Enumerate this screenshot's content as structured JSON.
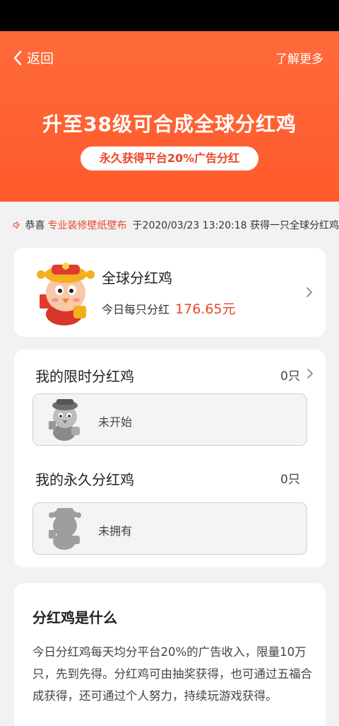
{
  "nav": {
    "back_label": "返回",
    "more_label": "了解更多"
  },
  "hero": {
    "title": "升至38级可合成全球分红鸡",
    "badge": "永久获得平台20%广告分红"
  },
  "marquee": {
    "prefix": "恭喜",
    "user": "专业装修壁纸壁布",
    "text": "于2020/03/23 13:20:18 获得一只全球分红鸡"
  },
  "global": {
    "title": "全球分红鸡",
    "sub_label": "今日每只分红",
    "amount": "176.65元"
  },
  "limited": {
    "title": "我的限时分红鸡",
    "count": "0只",
    "status": "未开始"
  },
  "permanent": {
    "title": "我的永久分红鸡",
    "count": "0只",
    "status": "未拥有"
  },
  "about": {
    "title": "分红鸡是什么",
    "body": "今日分红鸡每天均分平台20%的广告收入，限量10万只，先到先得。分红鸡可由抽奖获得，也可通过五福合成获得，还可通过个人努力，持续玩游戏获得。"
  },
  "colors": {
    "accent": "#e8472a",
    "hero": "#ff6a3a"
  }
}
